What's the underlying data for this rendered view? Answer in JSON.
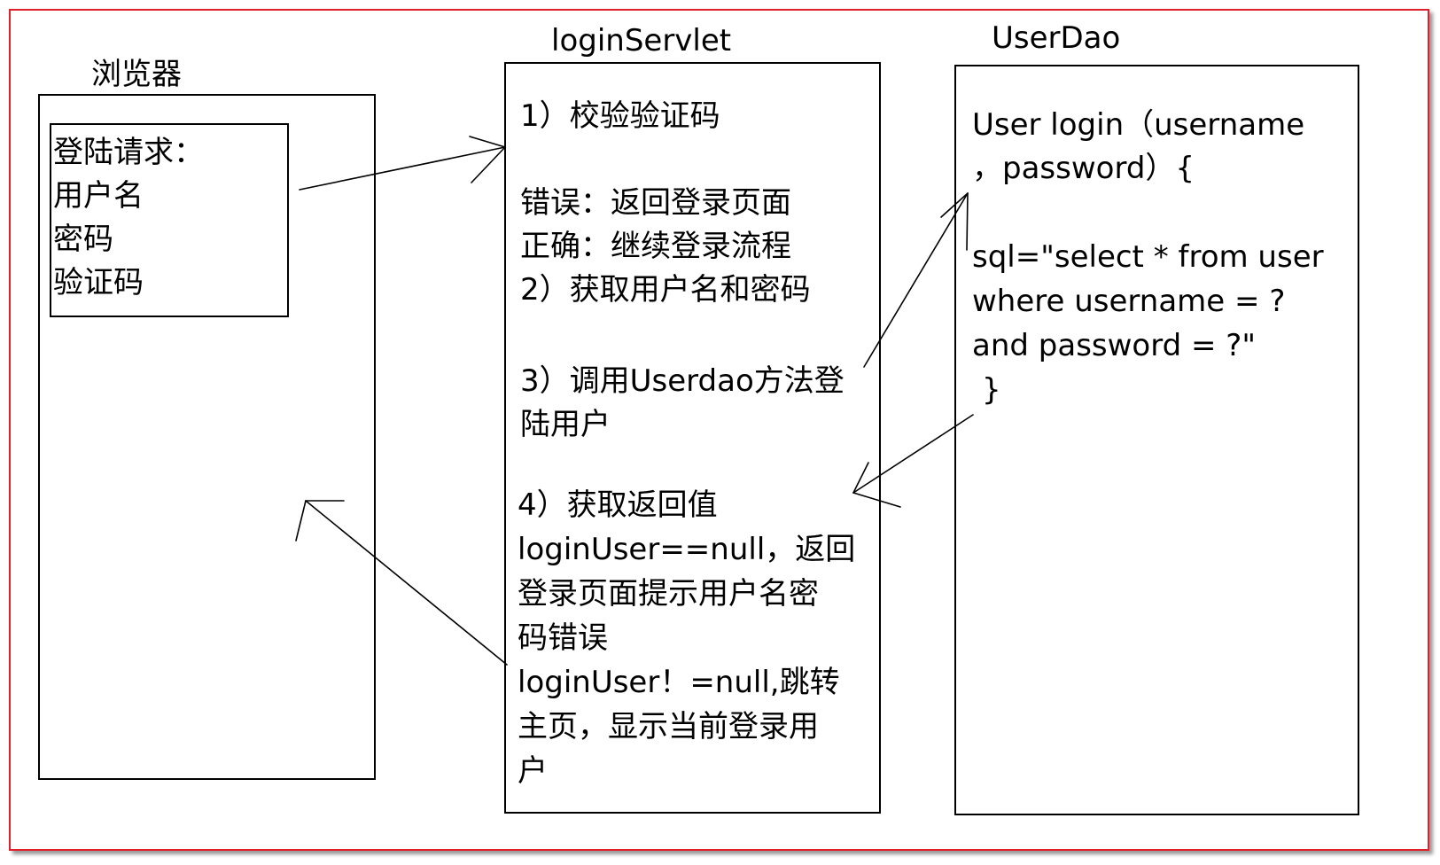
{
  "colors": {
    "frame": "#e0202a",
    "lines": "#000000",
    "background": "#ffffff"
  },
  "browser": {
    "title": "浏览器",
    "form_lines": [
      "登陆请求：",
      "用户名",
      "密码",
      "验证码"
    ]
  },
  "servlet": {
    "title": "loginServlet",
    "step1": "1）校验验证码",
    "step1_lines": [
      "错误：返回登录页面",
      "正确：继续登录流程"
    ],
    "step2": "2）获取用户名和密码",
    "step3_lines": [
      "3）调用Userdao方法登",
      "陆用户"
    ],
    "step4_lines": [
      "4）获取返回值",
      "loginUser==null，返回",
      "登录页面提示用户名密",
      "码错误",
      "loginUser！=null,跳转",
      "主页，显示当前登录用",
      "户"
    ]
  },
  "dao": {
    "title": "UserDao",
    "method_lines": [
      "User login（username",
      "，password）{"
    ],
    "sql_lines": [
      "sql=\"select * from user",
      "where username = ?",
      "and password = ?\""
    ],
    "closing": "}"
  }
}
